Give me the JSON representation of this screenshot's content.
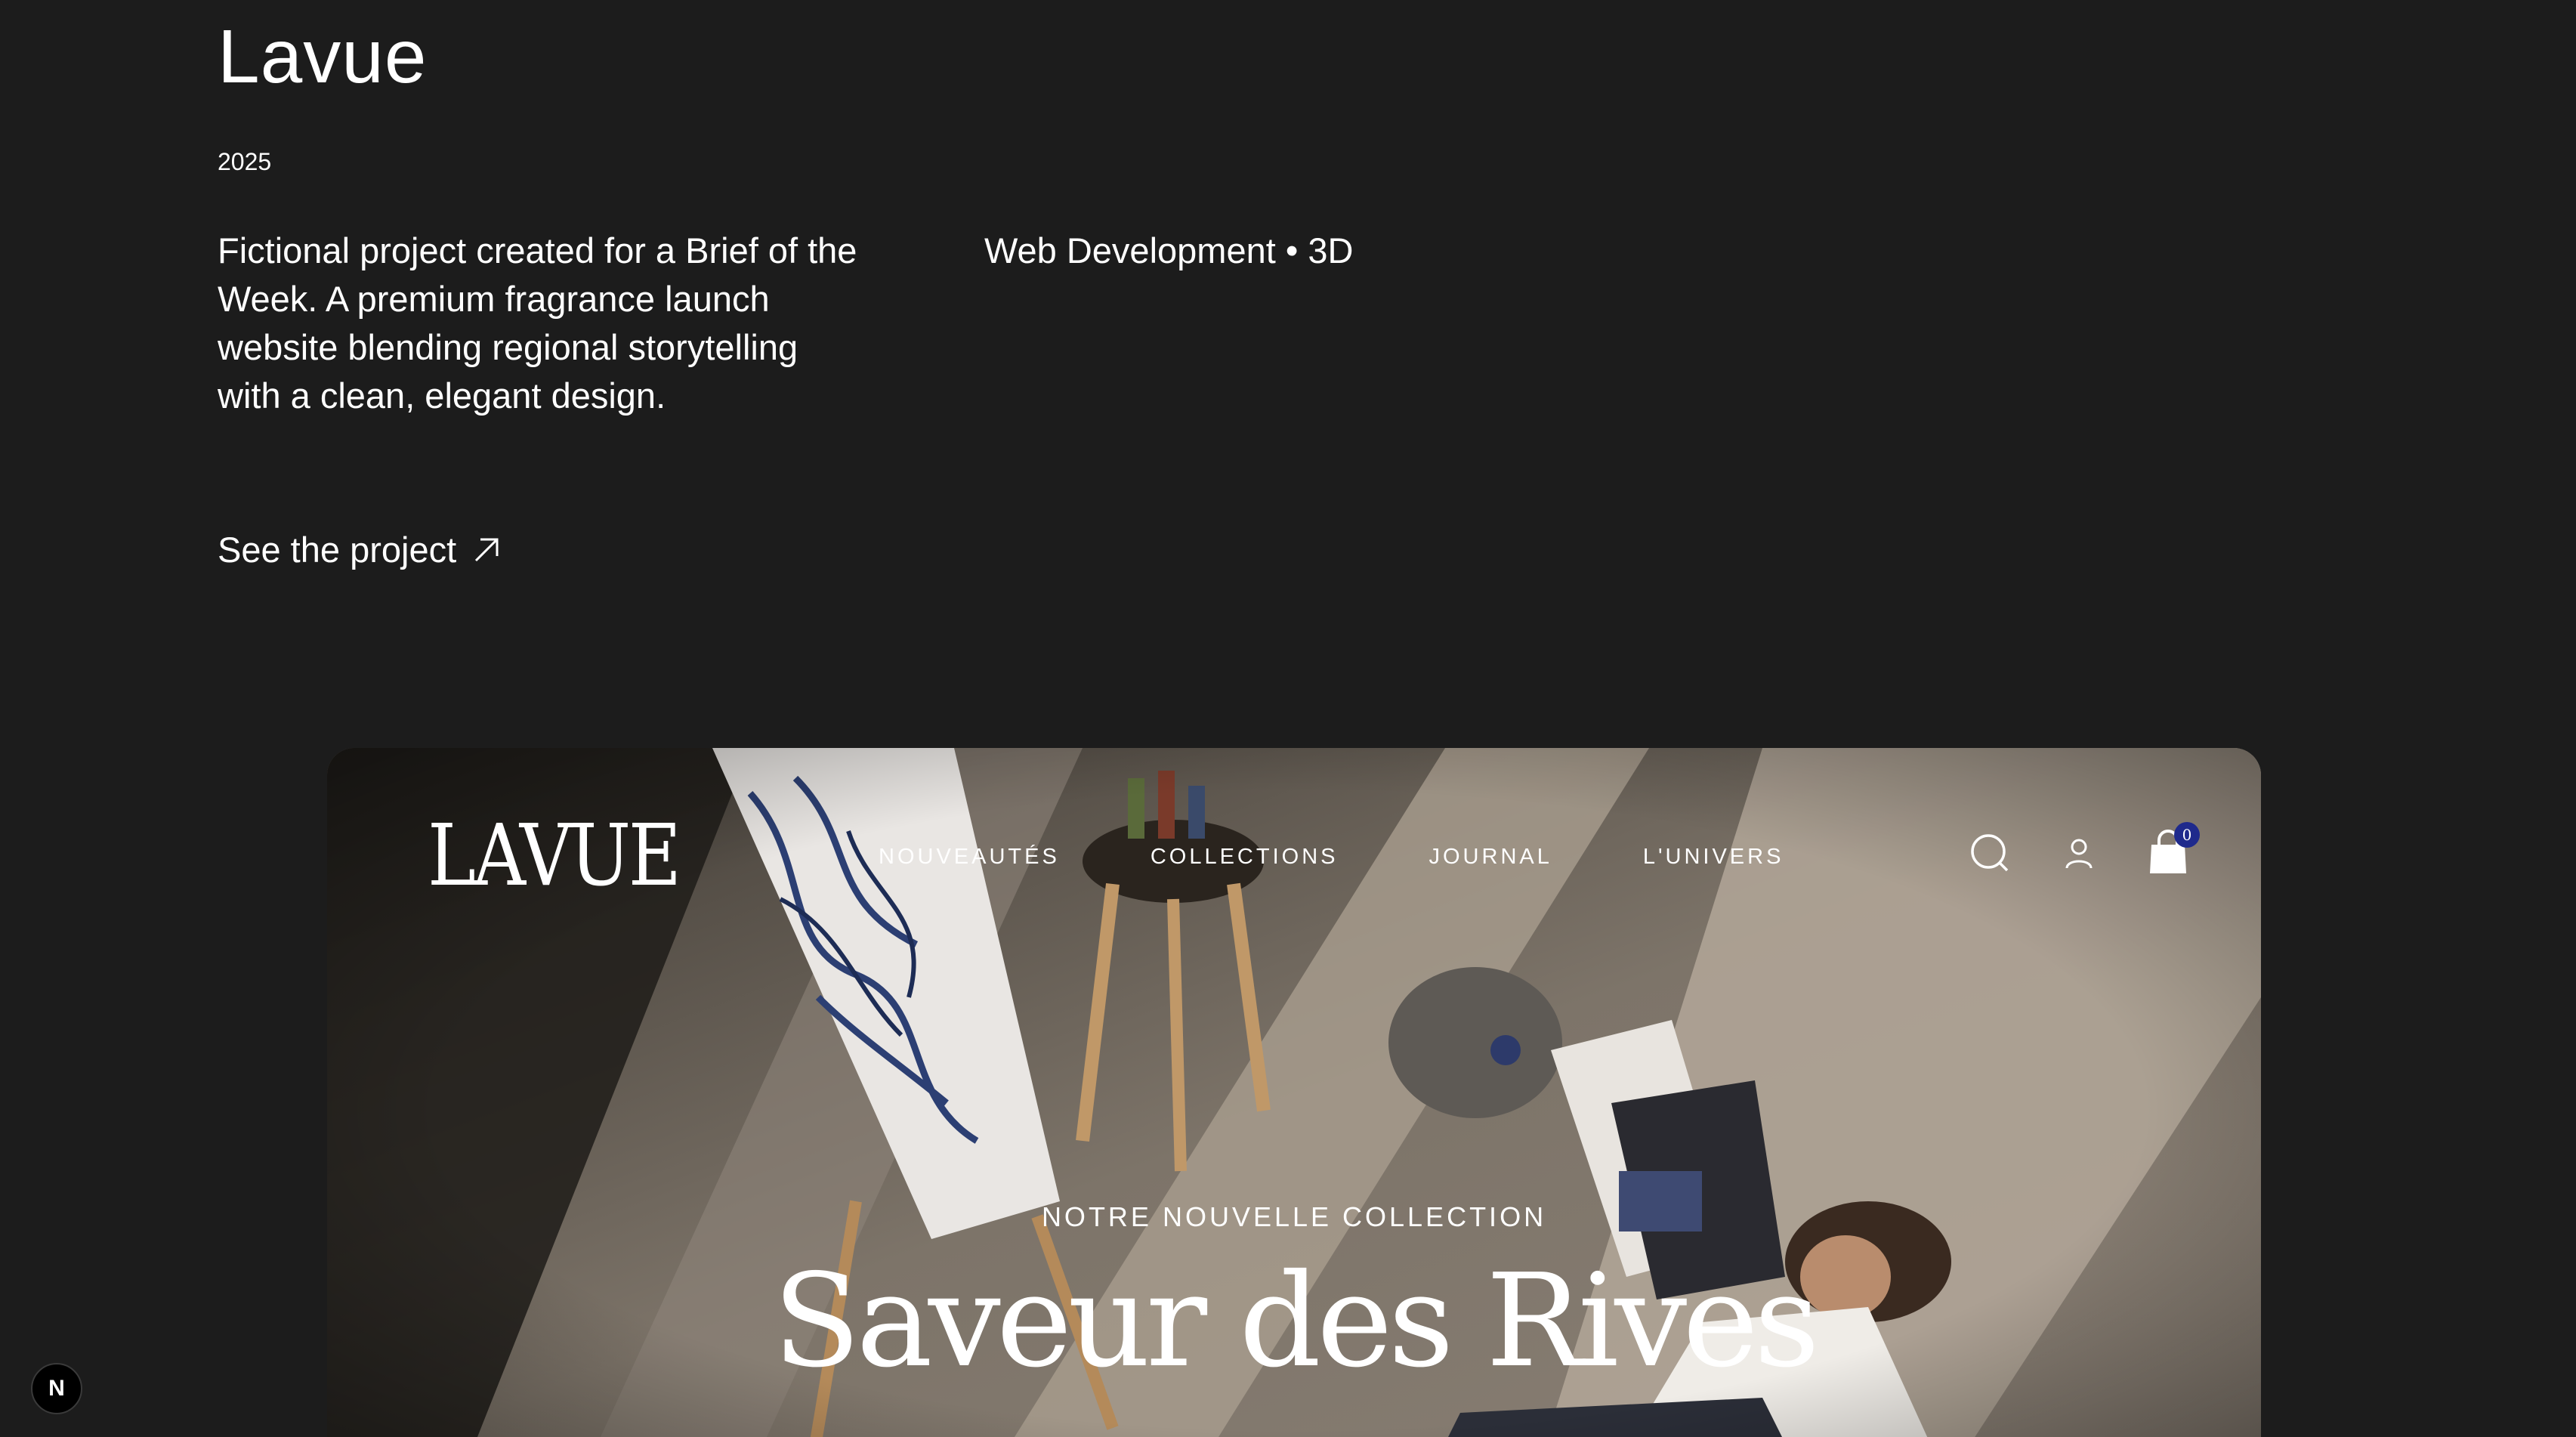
{
  "project": {
    "title": "Lavue",
    "year": "2025",
    "description": "Fictional project created for a Brief of the Week. A premium fragrance launch website blending regional storytelling with a clean, elegant design.",
    "tags": "Web Development • 3D",
    "link_label": "See the project"
  },
  "preview": {
    "brand": "LAVUE",
    "nav": [
      "NOUVEAUTÉS",
      "COLLECTIONS",
      "JOURNAL",
      "L'UNIVERS"
    ],
    "cart_count": "0",
    "kicker": "NOTRE NOUVELLE COLLECTION",
    "hero_title": "Saveur des Rives"
  },
  "dev_badge": "N",
  "colors": {
    "background": "#1c1c1c",
    "text": "#ffffff",
    "cart_badge": "#1f2a8c"
  },
  "icons": [
    "arrow-up-right-icon",
    "search-icon",
    "user-icon",
    "shopping-bag-icon"
  ]
}
